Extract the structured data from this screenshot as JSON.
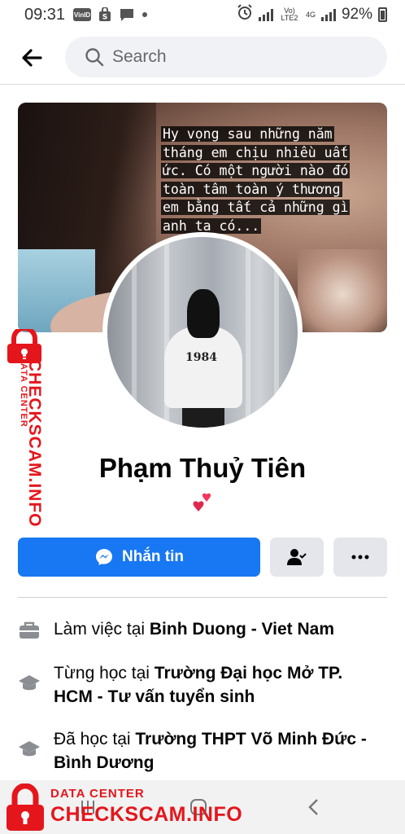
{
  "status_bar": {
    "time": "09:31",
    "left_icons": [
      "viettel-icon",
      "store-icon",
      "chat-icon",
      "dot-icon"
    ],
    "carrier_label": "Vo) LTE2",
    "network_label": "4G",
    "battery": "92%"
  },
  "header": {
    "search_placeholder": "Search"
  },
  "cover": {
    "caption_lines": [
      "Hy vọng sau những năm",
      "tháng em chịu nhiều uất",
      "ức. Có một người nào đó",
      "toàn tâm toàn ý thương",
      "em bằng tất cả những gì",
      "anh ta có..."
    ]
  },
  "avatar": {
    "shirt_print": "1984"
  },
  "profile": {
    "name": "Phạm Thuỷ Tiên",
    "emoji": "💕"
  },
  "actions": {
    "message_label": "Nhắn tin"
  },
  "intro": {
    "work_prefix": "Làm việc tại ",
    "work_place": "Binh Duong - Viet Nam",
    "edu1_prefix": "Từng học tại ",
    "edu1_place": "Trường Đại học Mở TP. HCM - Tư vấn tuyển sinh",
    "edu2_prefix": "Đã học tại ",
    "edu2_place": "Trường THPT Võ Minh Đức - Bình Dương"
  },
  "watermark": {
    "small": "DATA CENTER",
    "big": "CHECKSCAM.INFO"
  },
  "colors": {
    "primary": "#1877f2",
    "secondary_button": "#e4e6eb",
    "watermark_red": "#e4161c"
  }
}
